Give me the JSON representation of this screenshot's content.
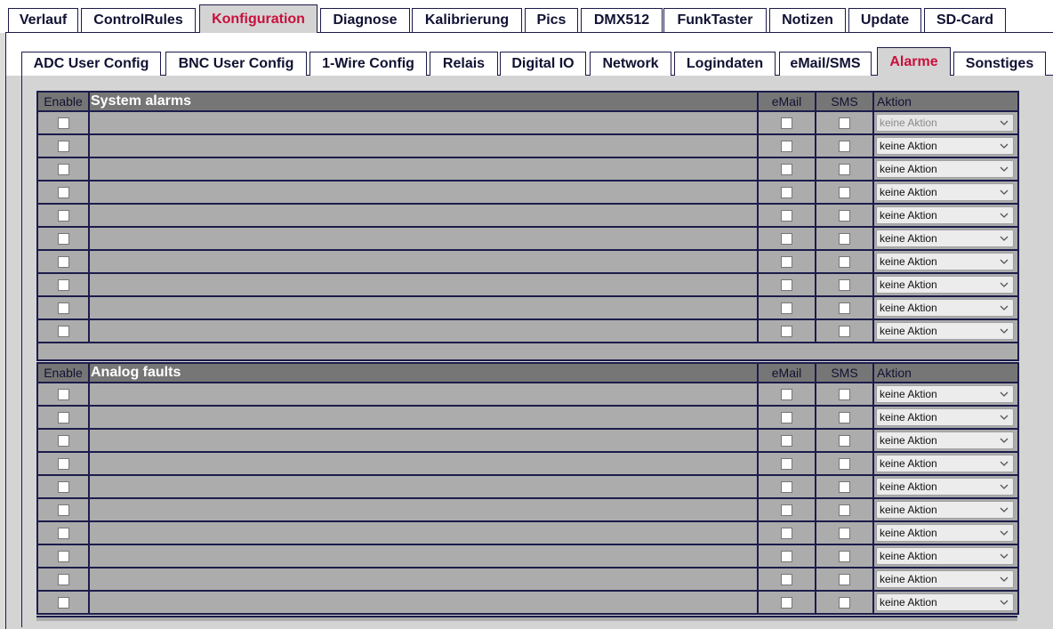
{
  "main_tabs": [
    {
      "label": "Verlauf",
      "active": false
    },
    {
      "label": "ControlRules",
      "active": false
    },
    {
      "label": "Konfiguration",
      "active": true
    },
    {
      "label": "Diagnose",
      "active": false
    },
    {
      "label": "Kalibrierung",
      "active": false
    },
    {
      "label": "Pics",
      "active": false
    },
    {
      "label": "DMX512",
      "active": false
    },
    {
      "label": "FunkTaster",
      "active": false
    },
    {
      "label": "Notizen",
      "active": false
    },
    {
      "label": "Update",
      "active": false
    },
    {
      "label": "SD-Card",
      "active": false
    }
  ],
  "sub_tabs": [
    {
      "label": "ADC User Config",
      "active": false
    },
    {
      "label": "BNC User Config",
      "active": false
    },
    {
      "label": "1-Wire Config",
      "active": false
    },
    {
      "label": "Relais",
      "active": false
    },
    {
      "label": "Digital IO",
      "active": false
    },
    {
      "label": "Network",
      "active": false
    },
    {
      "label": "Logindaten",
      "active": false
    },
    {
      "label": "eMail/SMS",
      "active": false
    },
    {
      "label": "Alarme",
      "active": true
    },
    {
      "label": "Sonstiges",
      "active": false
    }
  ],
  "columns": {
    "enable": "Enable",
    "email": "eMail",
    "sms": "SMS",
    "action": "Aktion"
  },
  "sections": [
    {
      "title": "System alarms",
      "rows": [
        {
          "action": "keine Aktion",
          "disabled": true
        },
        {
          "action": "keine Aktion",
          "disabled": false
        },
        {
          "action": "keine Aktion",
          "disabled": false
        },
        {
          "action": "keine Aktion",
          "disabled": false
        },
        {
          "action": "keine Aktion",
          "disabled": false
        },
        {
          "action": "keine Aktion",
          "disabled": false
        },
        {
          "action": "keine Aktion",
          "disabled": false
        },
        {
          "action": "keine Aktion",
          "disabled": false
        },
        {
          "action": "keine Aktion",
          "disabled": false
        },
        {
          "action": "keine Aktion",
          "disabled": false
        }
      ]
    },
    {
      "title": "Analog faults",
      "rows": [
        {
          "action": "keine Aktion",
          "disabled": false
        },
        {
          "action": "keine Aktion",
          "disabled": false
        },
        {
          "action": "keine Aktion",
          "disabled": false
        },
        {
          "action": "keine Aktion",
          "disabled": false
        },
        {
          "action": "keine Aktion",
          "disabled": false
        },
        {
          "action": "keine Aktion",
          "disabled": false
        },
        {
          "action": "keine Aktion",
          "disabled": false
        },
        {
          "action": "keine Aktion",
          "disabled": false
        },
        {
          "action": "keine Aktion",
          "disabled": false
        },
        {
          "action": "keine Aktion",
          "disabled": false
        }
      ]
    }
  ],
  "colors": {
    "active_tab_text": "#c8103c",
    "header_bg": "#767676",
    "row_bg": "#acacac",
    "border": "#1c1c4c"
  },
  "icons": {
    "select_arrow": "chevron-down-icon"
  }
}
